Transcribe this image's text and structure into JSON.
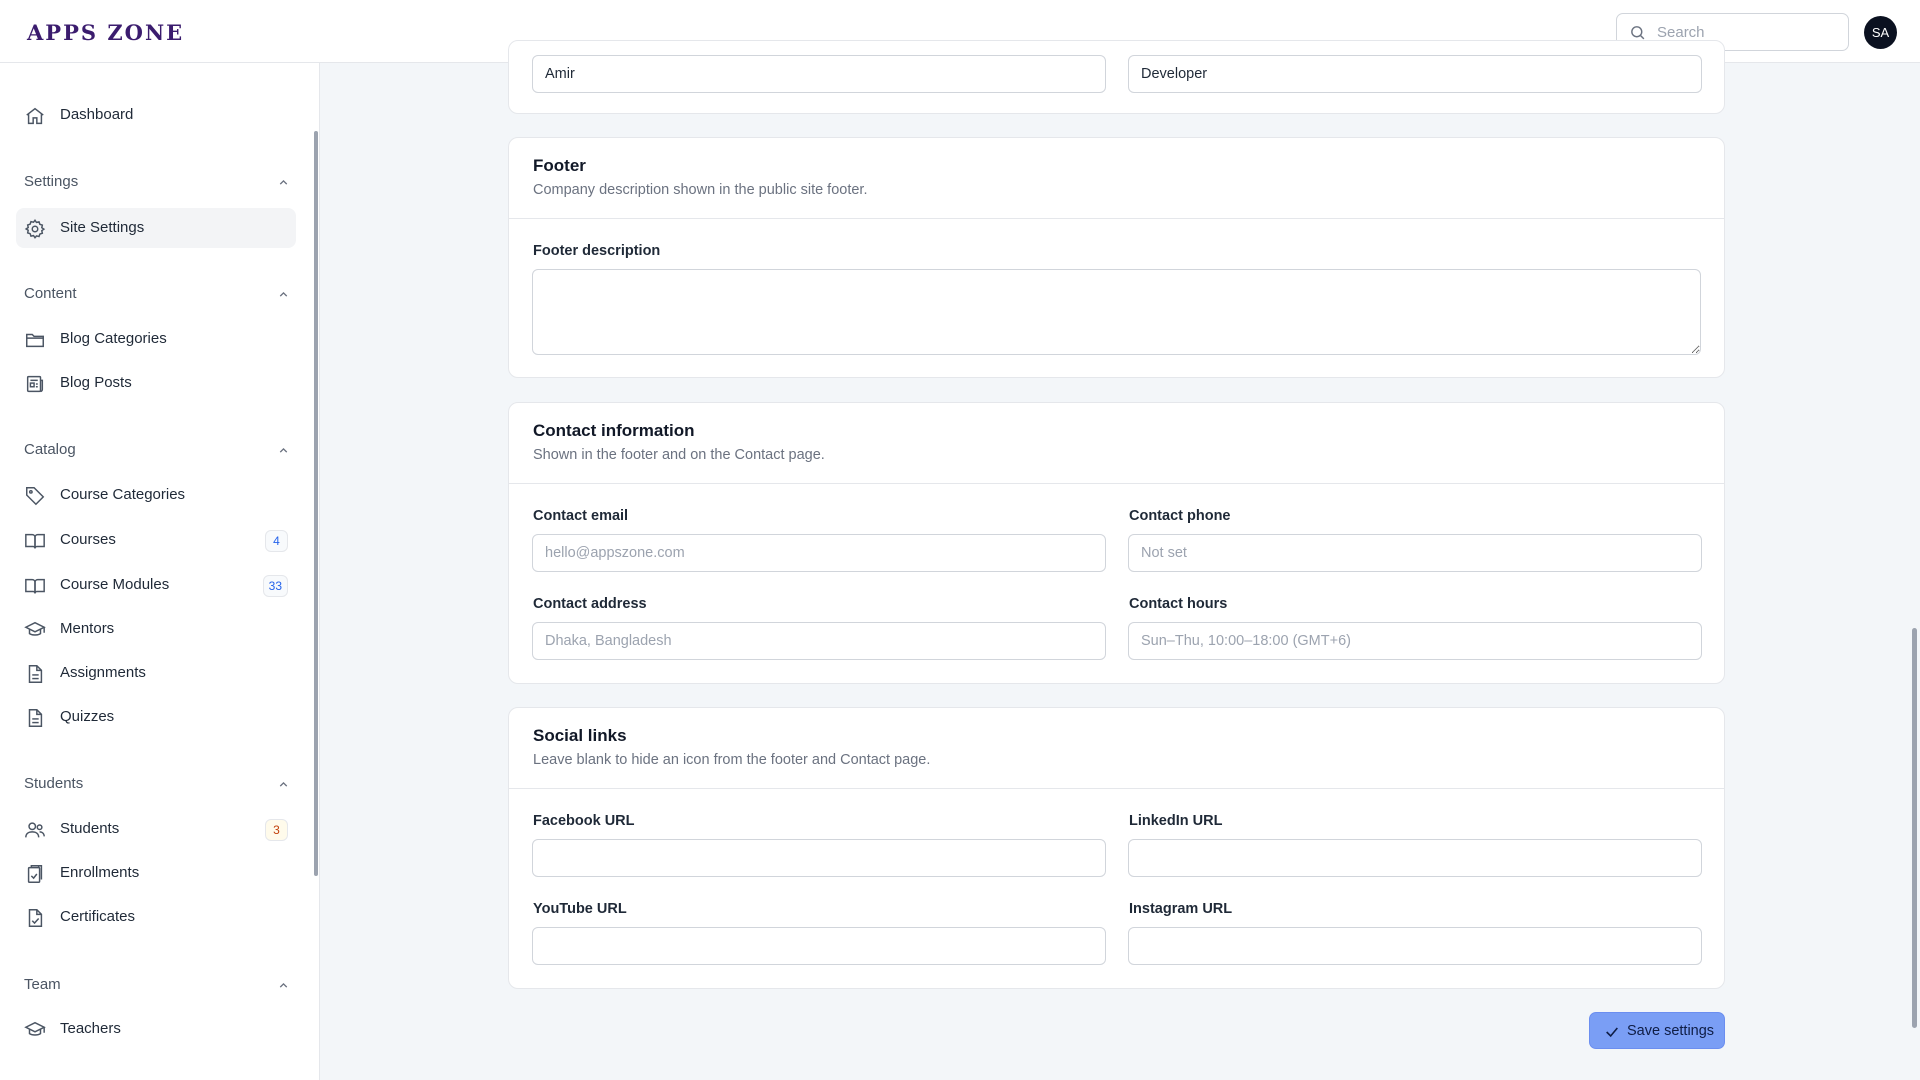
{
  "app": {
    "logo": "APPS ZONE"
  },
  "header": {
    "search_placeholder": "Search",
    "avatar_initials": "SA"
  },
  "sidebar": {
    "dashboard": "Dashboard",
    "groups": {
      "settings": "Settings",
      "content": "Content",
      "catalog": "Catalog",
      "students": "Students",
      "team": "Team"
    },
    "items": {
      "site_settings": "Site Settings",
      "blog_categories": "Blog Categories",
      "blog_posts": "Blog Posts",
      "course_categories": "Course Categories",
      "courses": "Courses",
      "courses_badge": "4",
      "course_modules": "Course Modules",
      "course_modules_badge": "33",
      "mentors": "Mentors",
      "assignments": "Assignments",
      "quizzes": "Quizzes",
      "students": "Students",
      "students_badge": "3",
      "enrollments": "Enrollments",
      "certificates": "Certificates",
      "teachers": "Teachers"
    }
  },
  "top_card": {
    "left_value": "Amir",
    "right_value": "Developer"
  },
  "footer_card": {
    "title": "Footer",
    "subtitle": "Company description shown in the public site footer.",
    "description_label": "Footer description",
    "description_value": ""
  },
  "contact_card": {
    "title": "Contact information",
    "subtitle": "Shown in the footer and on the Contact page.",
    "email_label": "Contact email",
    "email_placeholder": "hello@appszone.com",
    "phone_label": "Contact phone",
    "phone_placeholder": "Not set",
    "address_label": "Contact address",
    "address_placeholder": "Dhaka, Bangladesh",
    "hours_label": "Contact hours",
    "hours_placeholder": "Sun–Thu, 10:00–18:00 (GMT+6)"
  },
  "social_card": {
    "title": "Social links",
    "subtitle": "Leave blank to hide an icon from the footer and Contact page.",
    "facebook_label": "Facebook URL",
    "linkedin_label": "LinkedIn URL",
    "youtube_label": "YouTube URL",
    "instagram_label": "Instagram URL"
  },
  "actions": {
    "save_label": "Save settings"
  },
  "colors": {
    "brand": "#3b1c6e",
    "primary_button": "#7a9ef5",
    "page_bg": "#f3f6f9"
  }
}
